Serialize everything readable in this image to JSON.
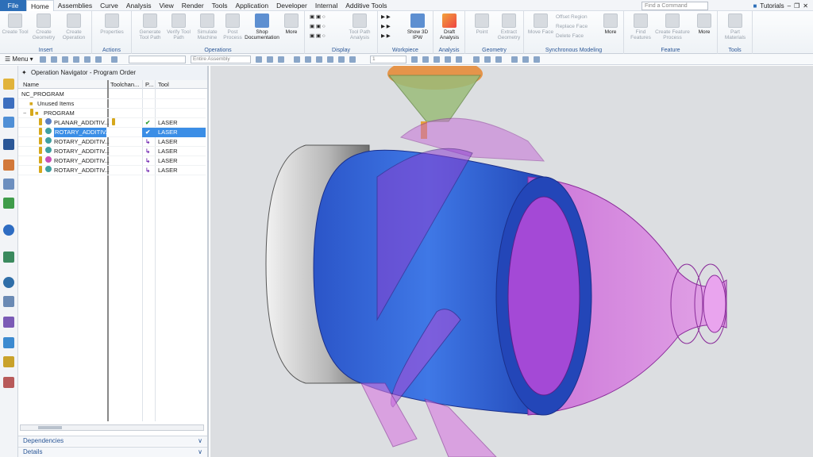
{
  "menubar": {
    "tabs": [
      "File",
      "Home",
      "Assemblies",
      "Curve",
      "Analysis",
      "View",
      "Render",
      "Tools",
      "Application",
      "Developer",
      "Internal",
      "Additive Tools"
    ],
    "find_placeholder": "Find a Command",
    "tutorials": "Tutorials"
  },
  "ribbon": {
    "insert": {
      "label": "Insert",
      "buttons": [
        "Create Tool",
        "Create Geometry",
        "Create Operation"
      ]
    },
    "actions": {
      "label": "Actions",
      "buttons": [
        "Properties"
      ]
    },
    "operations": {
      "label": "Operations",
      "buttons": [
        "Generate Tool Path",
        "Verify Tool Path",
        "Simulate Machine",
        "Post Process",
        "Shop Documentation",
        "More"
      ]
    },
    "display": {
      "label": "Display",
      "buttons": [
        "Tool Path Analysis"
      ]
    },
    "workpiece": {
      "label": "Workpiece",
      "buttons": [
        "Show 3D IPW"
      ]
    },
    "analysis": {
      "label": "Analysis",
      "buttons": [
        "Draft Analysis"
      ]
    },
    "geometry": {
      "label": "Geometry",
      "buttons": [
        "Point",
        "Extract Geometry"
      ]
    },
    "synchronous": {
      "label": "Synchronous Modeling",
      "buttons": [
        "Move Face",
        "Offset Region",
        "Replace Face",
        "Delete Face",
        "More"
      ]
    },
    "feature": {
      "label": "Feature",
      "buttons": [
        "Find Features",
        "Create Feature Process",
        "More"
      ]
    },
    "tools": {
      "label": "Tools",
      "buttons": [
        "Part Materials"
      ]
    }
  },
  "toolbar": {
    "menu_label": "Menu",
    "filter_value": "",
    "scope_value": "Entire Assembly",
    "layer_value": "1"
  },
  "navigator": {
    "title": "Operation Navigator - Program Order",
    "columns": [
      "Name",
      "Toolchan...",
      "P...",
      "Tool"
    ],
    "rows": [
      {
        "name": "NC_PROGRAM",
        "tool": "",
        "status": ""
      },
      {
        "name": "Unused Items",
        "tool": "",
        "status": ""
      },
      {
        "name": "PROGRAM",
        "tool": "",
        "status": ""
      },
      {
        "name": "PLANAR_ADDITIV...",
        "tool": "LASER",
        "status": "check"
      },
      {
        "name": "ROTARY_ADDITIV...",
        "tool": "LASER",
        "status": "check"
      },
      {
        "name": "ROTARY_ADDITIV...",
        "tool": "LASER",
        "status": "arrow"
      },
      {
        "name": "ROTARY_ADDITIV...",
        "tool": "LASER",
        "status": "arrow"
      },
      {
        "name": "ROTARY_ADDITIV...",
        "tool": "LASER",
        "status": "arrow"
      },
      {
        "name": "ROTARY_ADDITIV...",
        "tool": "LASER",
        "status": "arrow"
      }
    ],
    "dependencies": "Dependencies",
    "details": "Details"
  },
  "colors": {
    "accent": "#2d6fb8",
    "selection": "#3b8ee6",
    "part_blue": "#2f5fd8",
    "part_magenta": "#d86ee0"
  }
}
